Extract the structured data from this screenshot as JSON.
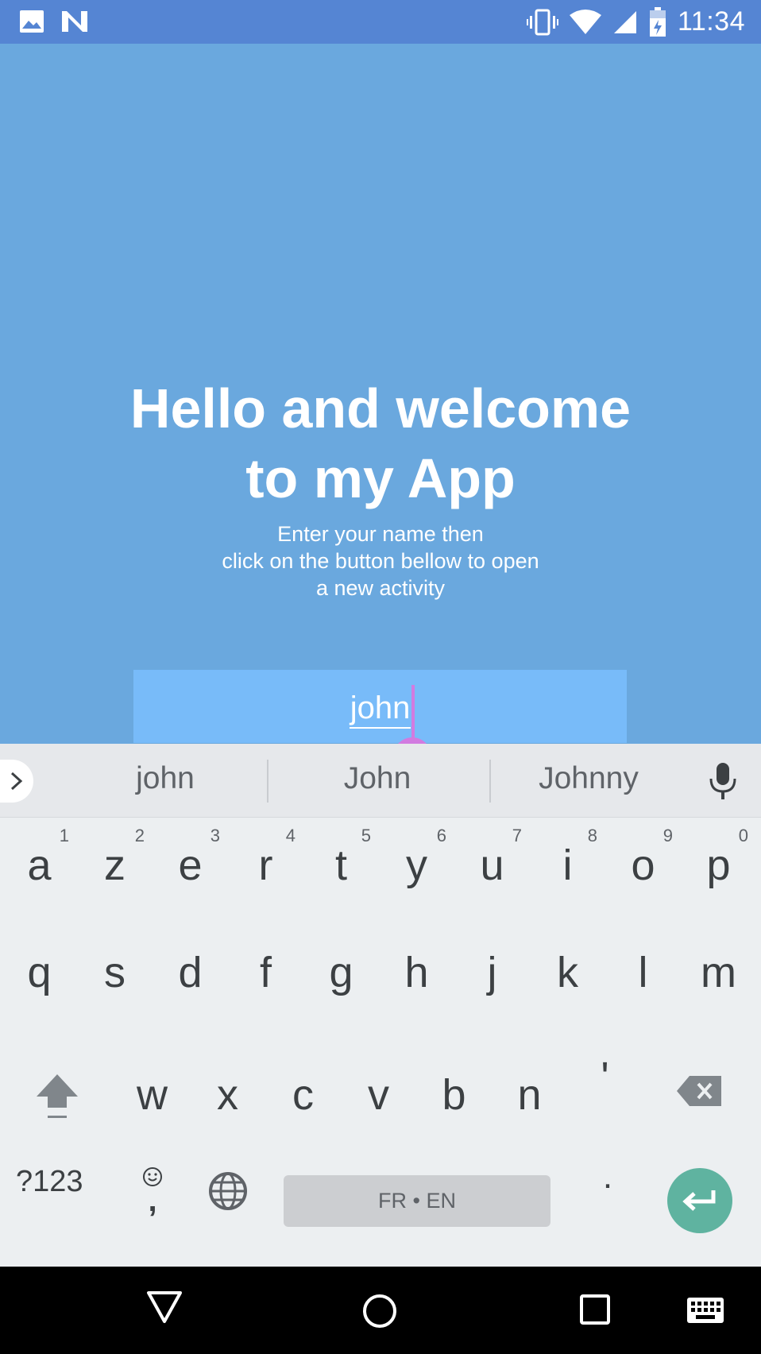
{
  "status_bar": {
    "time": "11:34",
    "left_icons": [
      "image-icon",
      "n-notification-icon"
    ],
    "right_icons": [
      "vibrate-icon",
      "wifi-icon",
      "signal-icon",
      "battery-icon"
    ]
  },
  "app": {
    "background_color": "#6aa8de",
    "title_lines": [
      "Hello and welcome",
      "to my App"
    ],
    "subtitle_lines": [
      "Enter your name then",
      "click on the button bellow to open",
      "a new activity"
    ],
    "name_input": {
      "value": "john"
    }
  },
  "keyboard": {
    "suggestions": [
      "john",
      "John",
      "Johnny"
    ],
    "row1": [
      {
        "key": "a",
        "num": "1"
      },
      {
        "key": "z",
        "num": "2"
      },
      {
        "key": "e",
        "num": "3"
      },
      {
        "key": "r",
        "num": "4"
      },
      {
        "key": "t",
        "num": "5"
      },
      {
        "key": "y",
        "num": "6"
      },
      {
        "key": "u",
        "num": "7"
      },
      {
        "key": "i",
        "num": "8"
      },
      {
        "key": "o",
        "num": "9"
      },
      {
        "key": "p",
        "num": "0"
      }
    ],
    "row2": [
      "q",
      "s",
      "d",
      "f",
      "g",
      "h",
      "j",
      "k",
      "l",
      "m"
    ],
    "row3": [
      "w",
      "x",
      "c",
      "v",
      "b",
      "n",
      "'"
    ],
    "symbols_label": "?123",
    "comma_label": ",",
    "space_label": "FR • EN",
    "period_label": ".",
    "enter_color": "#5fb3a0"
  },
  "nav_bar": {
    "buttons": [
      "back-icon",
      "home-icon",
      "recents-icon",
      "keyboard-switch-icon"
    ]
  }
}
